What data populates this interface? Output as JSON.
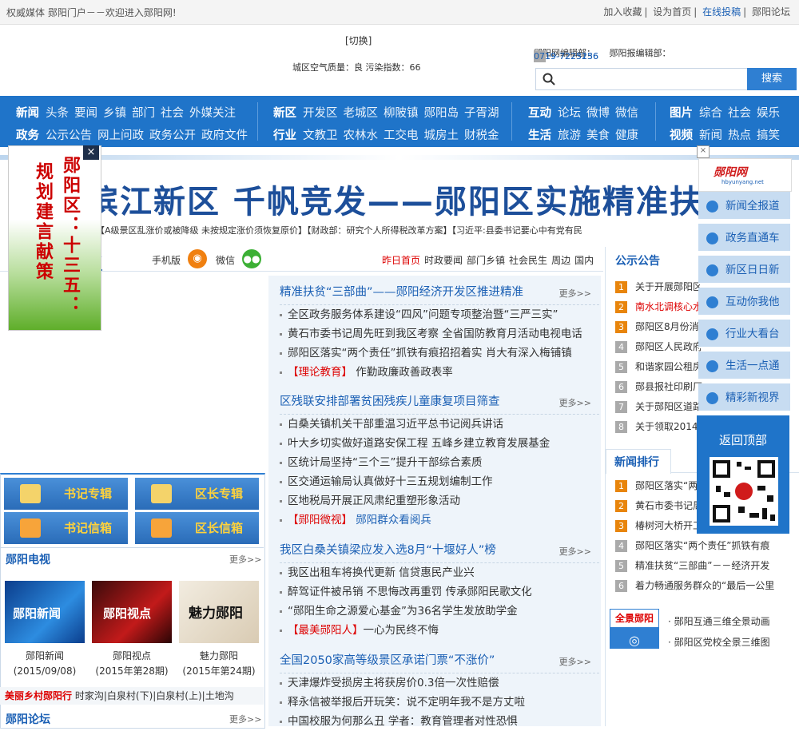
{
  "topbar": {
    "left": "权威媒体  郧阳门户－－欢迎进入郧阳网!",
    "links": [
      "加入收藏",
      "设为首页",
      "在线投稿",
      "郧阳论坛"
    ]
  },
  "header": {
    "switch": "[切换]",
    "air": "城区空气质量：良 污染指数：66",
    "phone1_label": "郧阳网编辑部：",
    "phone1": "0719-7223236",
    "phone2_label": "郧阳报编辑部：",
    "phone2": "0719-7225156",
    "search_placeholder": "",
    "search_button": "搜索"
  },
  "nav": {
    "group1": {
      "row1_head": "新闻",
      "row1": [
        "头条",
        "要闻",
        "乡镇",
        "部门",
        "社会",
        "外媒关注"
      ],
      "row2_head": "政务",
      "row2": [
        "公示公告",
        "网上问政",
        "政务公开",
        "政府文件"
      ]
    },
    "group2": {
      "row1_head": "新区",
      "row1": [
        "开发区",
        "老城区",
        "柳陂镇",
        "郧阳岛",
        "子胥湖"
      ],
      "row2_head": "行业",
      "row2": [
        "文教卫",
        "农林水",
        "工交电",
        "城房土",
        "财税金"
      ]
    },
    "group3": {
      "row1_head": "互动",
      "row1": [
        "论坛",
        "微博",
        "微信"
      ],
      "row2_head": "生活",
      "row2": [
        "旅游",
        "美食",
        "健康"
      ]
    },
    "group4": {
      "row1_head": "图片",
      "row1": [
        "综合",
        "社会",
        "娱乐"
      ],
      "row2_head": "视频",
      "row2": [
        "新闻",
        "热点",
        "搞笑"
      ]
    }
  },
  "banner": {
    "title": "滨江新区 千帆竞发——郧阳区实施精准扶贫",
    "ticker": "【A级景区乱涨价或被降级 未按规定涨价须恢复原价】【财政部：研究个人所得税改革方案】【习近平:县委书记要心中有党有民"
  },
  "left_ad": {
    "col1": "规划建言献策",
    "col2": "郧阳区：十三五：",
    "close": "×"
  },
  "strip": {
    "title_fragment": "首",
    "mobile": "手机版",
    "wechat": "微信",
    "tabs": [
      "昨日首页",
      "时政要闻",
      "部门乡镇",
      "社会民生",
      "周边",
      "国内"
    ]
  },
  "news": [
    {
      "title": "精准扶贫“三部曲”——郧阳经济开发区推进精准",
      "more": "更多>>",
      "items": [
        {
          "text": "全区政务服务体系建设“四风”问题专项整治暨“三严三实”"
        },
        {
          "text": "黄石市委书记周先旺到我区考察 全省国防教育月活动电视电话"
        },
        {
          "text": "郧阳区落实“两个责任”抓铁有痕招招着实 肖大有深入梅铺镇"
        },
        {
          "tag": "【理论教育】",
          "text": " 作勤政廉政善政表率"
        }
      ]
    },
    {
      "title": "区残联安排部署贫困残疾儿童康复项目筛查",
      "more": "更多>>",
      "items": [
        {
          "text": "白桑关镇机关干部重温习近平总书记阅兵讲话"
        },
        {
          "text": "叶大乡切实做好道路安保工程 五峰乡建立教育发展基金"
        },
        {
          "text": "区统计局坚持“三个三”提升干部综合素质"
        },
        {
          "text": "区交通运输局认真做好十三五规划编制工作"
        },
        {
          "text": "区地税局开展正风肃纪重塑形象活动"
        },
        {
          "tag": "【郧阳微视】",
          "text": " 郧阳群众看阅兵"
        }
      ]
    },
    {
      "title": "我区白桑关镇梁应发入选8月“十堰好人”榜",
      "more": "更多>>",
      "items": [
        {
          "text": "我区出租车将换代更新 信贷惠民产业兴"
        },
        {
          "text": "醉驾证件被吊销 不思悔改再重罚 传承郧阳民歌文化"
        },
        {
          "text": "“郧阳生命之源爱心基金”为36名学生发放助学金"
        },
        {
          "tag": "【最美郧阳人】",
          "text": "一心为民终不悔"
        }
      ]
    },
    {
      "title": "全国2050家高等级景区承诺门票“不涨价”",
      "more": "更多>>",
      "items": [
        {
          "text": "天津爆炸受损房主将获房价0.3倍一次性赔偿"
        },
        {
          "text": "释永信被举报后开玩笑：说不定明年我不是方丈啦"
        },
        {
          "text": "中国校服为何那么丑 学者：教育管理者对性恐惧"
        }
      ]
    }
  ],
  "mailboxes": {
    "secretary_column": "书记专辑",
    "mayor_column": "区长专辑",
    "secretary_mail": "书记信箱",
    "mayor_mail": "区长信箱"
  },
  "tv": {
    "title": "郧阳电视",
    "more": "更多>>",
    "items": [
      {
        "name": "郧阳新闻",
        "date": "(2015/09/08)",
        "logo": "郧阳新闻"
      },
      {
        "name": "郧阳视点",
        "date": "(2015年第28期)",
        "logo": "郧阳视点"
      },
      {
        "name": "魅力郧阳",
        "date": "(2015年第24期)",
        "logo": "魅力郧阳"
      }
    ]
  },
  "village": {
    "title": "美丽乡村郧阳行",
    "items": "时家沟|白泉村(下)|白泉村(上)|土地沟"
  },
  "forum": {
    "title": "郧阳论坛",
    "more": "更多>>"
  },
  "notice": {
    "title": "公示公告",
    "items": [
      {
        "n": "1",
        "text": "关于开展郧阳区"
      },
      {
        "n": "2",
        "text": "南水北调核心水",
        "red": true
      },
      {
        "n": "3",
        "text": "郧阳区8月份消"
      },
      {
        "n": "4",
        "text": "郧阳区人民政府"
      },
      {
        "n": "5",
        "text": "和谐家园公租房"
      },
      {
        "n": "6",
        "text": "郧县报社印刷厂"
      },
      {
        "n": "7",
        "text": "关于郧阳区道路"
      },
      {
        "n": "8",
        "text": "关于领取2014年"
      }
    ]
  },
  "ranking": {
    "title": "新闻排行",
    "items": [
      {
        "n": "1",
        "text": "郧阳区落实“两"
      },
      {
        "n": "2",
        "text": "黄石市委书记周"
      },
      {
        "n": "3",
        "text": "椿树河大桥开工"
      },
      {
        "n": "4",
        "text": "郧阳区落实“两个责任”抓铁有痕"
      },
      {
        "n": "5",
        "text": "精准扶贫“三部曲”－－经济开发"
      },
      {
        "n": "6",
        "text": "着力畅通服务群众的“最后一公里"
      }
    ]
  },
  "panorama": {
    "label": "全景郧阳",
    "links": [
      "· 郧阳互通三维全景动画",
      "· 郧阳区党校全景三维图"
    ]
  },
  "float_panel": {
    "logo": "郧阳网",
    "logo_url": "hbyunyang.net",
    "items": [
      "新闻全报道",
      "政务直通车",
      "新区日日新",
      "互动你我他",
      "行业大看台",
      "生活一点通",
      "精彩新视界"
    ],
    "back_top": "返回顶部",
    "close": "×"
  },
  "colors": {
    "nav_blue": "#1f74c9",
    "link_blue": "#1a5fb4",
    "accent_red": "#dd0000",
    "rank_orange": "#e8850c"
  }
}
